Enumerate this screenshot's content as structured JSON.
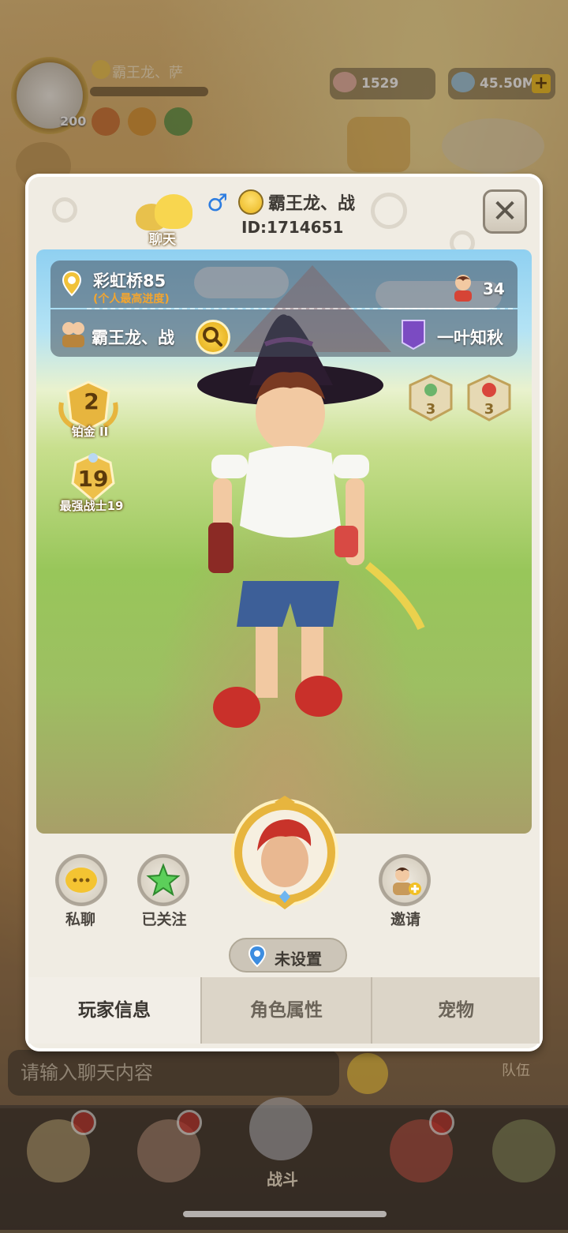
{
  "hud": {
    "player_name": "霸王龙、萨",
    "level": "200",
    "shells": "1529",
    "crystals": "45.50M"
  },
  "profile": {
    "chat_label": "聊天",
    "gender_symbol": "♂",
    "name": "霸王龙、战",
    "id": "ID:1714651",
    "close_symbol": "✕"
  },
  "info": {
    "location": "彩虹桥85",
    "location_sub": "(个人最高进度)",
    "likes": "34",
    "guild": "霸王龙、战",
    "partner": "一叶知秋"
  },
  "ranks": {
    "tier_num": "2",
    "tier_label": "铂金 II",
    "strongest_num": "19",
    "strongest_label": "最强战士19",
    "skill1": "3",
    "skill2": "3"
  },
  "actions": {
    "private_chat": "私聊",
    "followed": "已关注",
    "invite": "邀请",
    "location_unset": "未设置"
  },
  "tabs": [
    "玩家信息",
    "角色属性",
    "宠物"
  ],
  "background": {
    "chat_placeholder": "请输入聊天内容",
    "team": "队伍",
    "battle": "战斗"
  },
  "colors": {
    "panel": "#f0ece3",
    "accent_gold": "#e0a915",
    "gender_blue": "#2e7de0"
  }
}
